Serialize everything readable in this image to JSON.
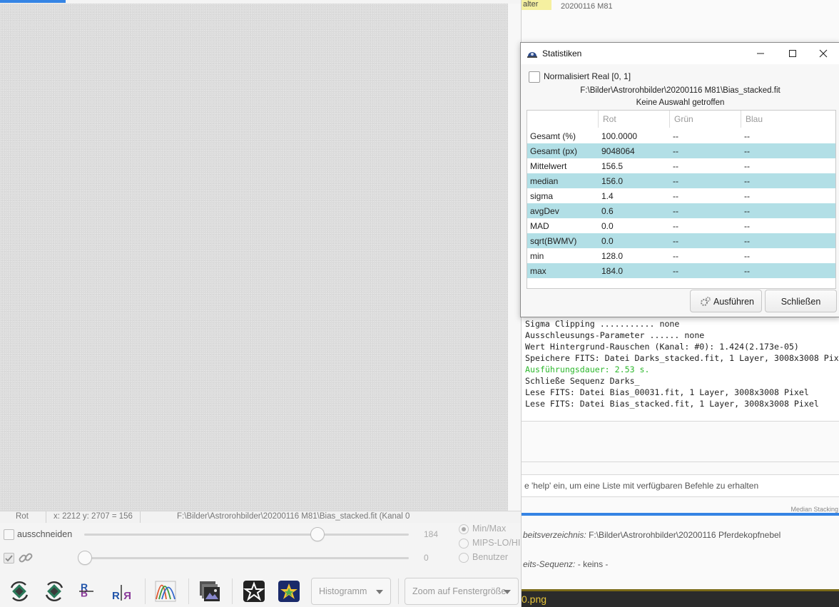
{
  "image_window": {
    "status": {
      "channel": "Rot",
      "coords": "x: 2212 y: 2707 = 156",
      "file": "F:\\Bilder\\Astrorohbilder\\20200116 M81\\Bias_stacked.fit (Kanal 0"
    },
    "controls": {
      "crop_label": "ausschneiden",
      "high_value": "184",
      "low_value": "0",
      "high_fraction": 0.77,
      "low_fraction": 0.0,
      "radio_options": [
        "Min/Max",
        "MIPS-LO/HI",
        "Benutzer"
      ],
      "radio_selected": 0
    },
    "toolbar": {
      "icons": [
        "rotate-left-icon",
        "rotate-right-icon",
        "mirror-x-icon",
        "mirror-y-icon",
        "curves-icon",
        "image-stack-icon",
        "star-icon",
        "colored-star-icon"
      ],
      "histogram_combo": "Histogramm",
      "zoom_combo": "Zoom auf Fenstergröße"
    }
  },
  "main_window": {
    "top_tab_fragment": "alter",
    "top_tab_text": "20200116 M81",
    "console_lines": [
      {
        "text": "Sigma Clipping ........... none",
        "color": "default"
      },
      {
        "text": "Ausschleusungs-Parameter ...... none",
        "color": "default"
      },
      {
        "text": "Wert Hintergrund-Rauschen (Kanal: #0): 1.424(2.173e-05)",
        "color": "default"
      },
      {
        "text": "Speichere FITS: Datei Darks_stacked.fit, 1 Layer, 3008x3008 Pix",
        "color": "default"
      },
      {
        "text": "Ausführungsdauer: 2.53 s.",
        "color": "green"
      },
      {
        "text": "Schließe Sequenz Darks_",
        "color": "default"
      },
      {
        "text": "Lese FITS: Datei Bias_00031.fit, 1 Layer, 3008x3008 Pixel",
        "color": "default"
      },
      {
        "text": "Lese FITS: Datei Bias_stacked.fit, 1 Layer, 3008x3008 Pixel",
        "color": "default"
      }
    ],
    "command_hint": "e 'help' ein, um eine Liste mit verfügbaren Befehle zu erhalten",
    "progress_label": "Median Stacking",
    "progress": 1.0,
    "working_dir_label": "beitsverzeichnis:",
    "working_dir_value": "F:\\Bilder\\Astrorohbilder\\20200116 Pferdekopfnebel",
    "sequence_label": "eits-Sequenz:",
    "sequence_value": "- keins -",
    "bottom_text": "0.png"
  },
  "stats_dialog": {
    "title": "Statistiken",
    "normalize_label": "Normalisiert Real [0, 1]",
    "file_path": "F:\\Bilder\\Astrorohbilder\\20200116 M81\\Bias_stacked.fit",
    "selection_note": "Keine Auswahl getroffen",
    "headers": [
      "",
      "Rot",
      "Grün",
      "Blau"
    ],
    "rows": [
      [
        "Gesamt (%)",
        "100.0000",
        "--",
        "--"
      ],
      [
        "Gesamt (px)",
        "9048064",
        "--",
        "--"
      ],
      [
        "Mittelwert",
        "156.5",
        "--",
        "--"
      ],
      [
        "median",
        "156.0",
        "--",
        "--"
      ],
      [
        "sigma",
        "1.4",
        "--",
        "--"
      ],
      [
        "avgDev",
        "0.6",
        "--",
        "--"
      ],
      [
        "MAD",
        "0.0",
        "--",
        "--"
      ],
      [
        "sqrt(BWMV)",
        "0.0",
        "--",
        "--"
      ],
      [
        "min",
        "128.0",
        "--",
        "--"
      ],
      [
        "max",
        "184.0",
        "--",
        "--"
      ]
    ],
    "run_button": "Ausführen",
    "close_button": "Schließen"
  }
}
